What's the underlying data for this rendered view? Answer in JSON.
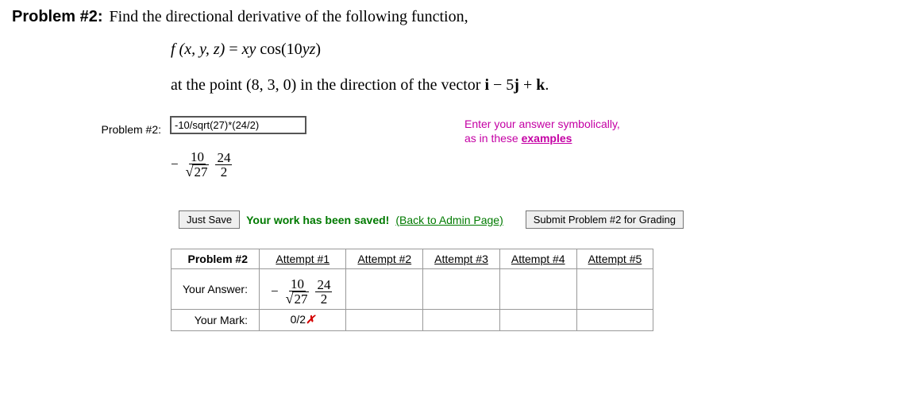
{
  "header": {
    "problem_label": "Problem #2:",
    "instruction": "Find the directional derivative of the following function,"
  },
  "equation": {
    "lhs": "f (x, y, z)",
    "eq": " = ",
    "rhs_a": "xy",
    "rhs_b": " cos(10",
    "rhs_c": "yz",
    "rhs_d": ")"
  },
  "line2": {
    "text_a": "at the point (8, 3, 0) in the direction of the vector ",
    "vec_i": "i",
    "mid": " − 5",
    "vec_j": "j",
    "plus": " + ",
    "vec_k": "k",
    "dot": "."
  },
  "side_label": "Problem #2:",
  "input_value": "-10/sqrt(27)*(24/2)",
  "hint_line1": "Enter your answer symbolically,",
  "hint_line2a": "as in these ",
  "hint_link": "examples",
  "parsed": {
    "sign": "−",
    "f1_num": "10",
    "f1_den_rad": "27",
    "f2_num": "24",
    "f2_den": "2"
  },
  "buttons": {
    "just_save": "Just Save",
    "saved_msg": "Your work has been saved!",
    "admin_link": "(Back to Admin Page)",
    "submit": "Submit Problem #2 for Grading"
  },
  "table": {
    "h0": "Problem #2",
    "h1": "Attempt #1",
    "h2": "Attempt #2",
    "h3": "Attempt #3",
    "h4": "Attempt #4",
    "h5": "Attempt #5",
    "row_answer": "Your Answer:",
    "row_mark": "Your Mark:",
    "mark_val": "0/2",
    "mark_x": "✗"
  }
}
